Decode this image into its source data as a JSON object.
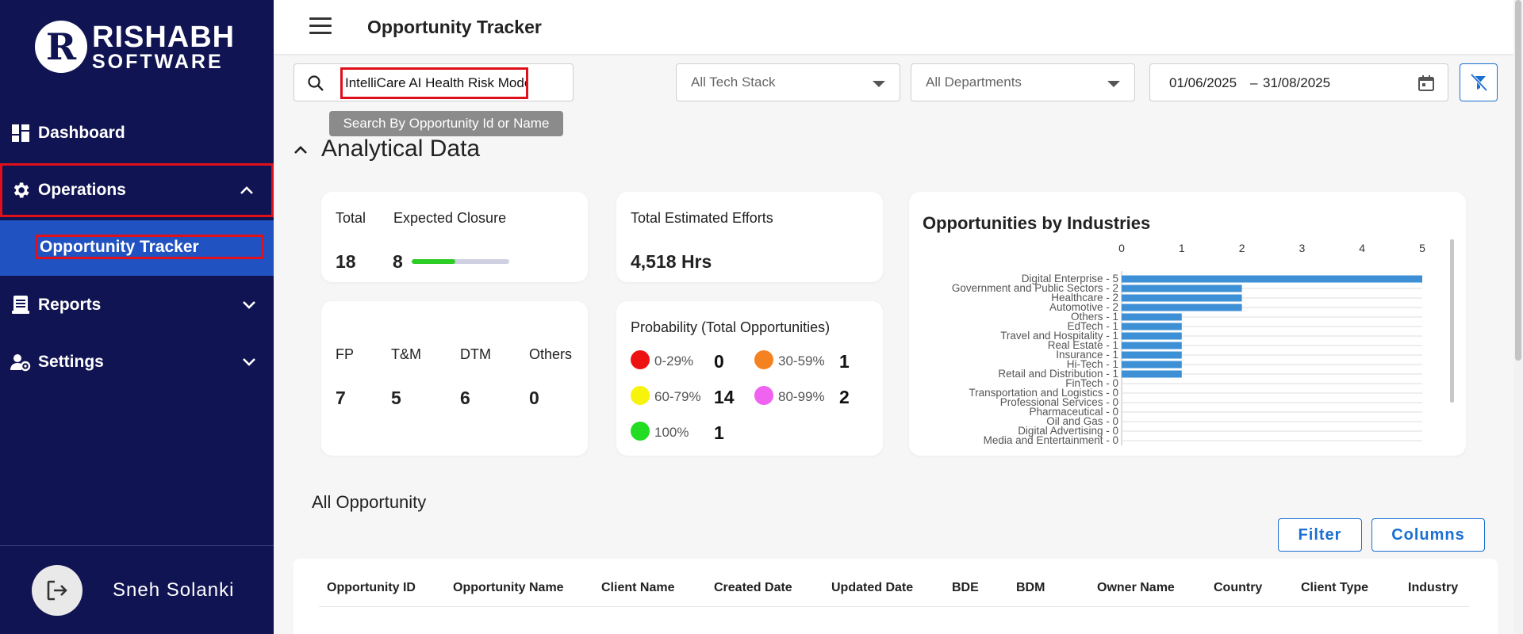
{
  "brand": {
    "line1": "RISHABH",
    "line2": "SOFTWARE",
    "mark": "R"
  },
  "sidebar": {
    "items": [
      {
        "label": "Dashboard",
        "icon": "dashboard-icon"
      },
      {
        "label": "Operations",
        "icon": "gear-icon",
        "expanded": true
      },
      {
        "label": "Reports",
        "icon": "report-icon"
      },
      {
        "label": "Settings",
        "icon": "user-settings-icon"
      }
    ],
    "subitems": [
      {
        "label": "Opportunity Tracker",
        "active": true
      }
    ],
    "user": {
      "name": "Sneh Solanki"
    }
  },
  "header": {
    "title": "Opportunity Tracker"
  },
  "filters": {
    "search_value": "IntelliCare AI Health Risk Model",
    "search_tooltip": "Search By Opportunity Id or Name",
    "tech_stack": "All Tech Stack",
    "departments": "All Departments",
    "date_from": "01/06/2025",
    "date_sep": "–",
    "date_to": "31/08/2025"
  },
  "analytics": {
    "title": "Analytical Data",
    "total_label": "Total",
    "total_value": "18",
    "expected_closure_label": "Expected Closure",
    "expected_closure_value": "8",
    "expected_closure_fraction": 0.444,
    "efforts_label": "Total Estimated Efforts",
    "efforts_value": "4,518 Hrs",
    "types": [
      {
        "label": "FP",
        "value": "7"
      },
      {
        "label": "T&M",
        "value": "5"
      },
      {
        "label": "DTM",
        "value": "6"
      },
      {
        "label": "Others",
        "value": "0"
      }
    ],
    "probability_title": "Probability (Total Opportunities)",
    "probability": [
      {
        "range": "0-29%",
        "value": "0",
        "color": "#ee1111"
      },
      {
        "range": "30-59%",
        "value": "1",
        "color": "#f58220"
      },
      {
        "range": "60-79%",
        "value": "14",
        "color": "#f7f30a"
      },
      {
        "range": "80-99%",
        "value": "2",
        "color": "#f062f0"
      },
      {
        "range": "100%",
        "value": "1",
        "color": "#22dd22"
      }
    ]
  },
  "chart_data": {
    "type": "bar",
    "orientation": "horizontal",
    "title": "Opportunities by Industries",
    "categories": [
      "Digital Enterprise - 5",
      "Government and Public Sectors - 2",
      "Healthcare - 2",
      "Automotive - 2",
      "Others - 1",
      "EdTech - 1",
      "Travel and Hospitality - 1",
      "Real Estate - 1",
      "Insurance - 1",
      "Hi-Tech - 1",
      "Retail and Distribution - 1",
      "FinTech - 0",
      "Transportation and Logistics - 0",
      "Professional Services - 0",
      "Pharmaceutical - 0",
      "Oil and Gas - 0",
      "Digital Advertising - 0",
      "Media and Entertainment - 0"
    ],
    "values": [
      5,
      2,
      2,
      2,
      1,
      1,
      1,
      1,
      1,
      1,
      1,
      0,
      0,
      0,
      0,
      0,
      0,
      0
    ],
    "xticks": [
      "0",
      "1",
      "2",
      "3",
      "4",
      "5"
    ],
    "xlim": [
      0,
      5
    ],
    "bar_color": "#3d8fd6",
    "grid": true
  },
  "opportunities": {
    "title": "All Opportunity",
    "filter_button": "Filter",
    "columns_button": "Columns",
    "columns": [
      "Opportunity ID",
      "Opportunity Name",
      "Client Name",
      "Created Date",
      "Updated Date",
      "BDE",
      "BDM",
      "Owner Name",
      "Country",
      "Client Type",
      "Industry"
    ]
  }
}
